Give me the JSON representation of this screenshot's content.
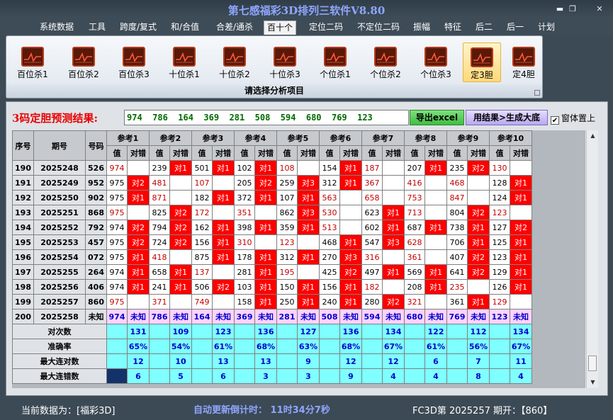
{
  "window": {
    "title": "第七感福彩3D排列三软件V8.80"
  },
  "menu": [
    "系统数据",
    "工具",
    "跨度/复式",
    "和/合值",
    "合差/通杀",
    "百十个",
    "定位二码",
    "不定位二码",
    "振幅",
    "特征",
    "后二",
    "后一",
    "计划"
  ],
  "menu_active": "百十个",
  "ribbon": {
    "buttons": [
      "百位杀1",
      "百位杀2",
      "百位杀3",
      "十位杀1",
      "十位杀2",
      "十位杀3",
      "个位杀1",
      "个位杀2",
      "个位杀3",
      "定3胆",
      "定4胆"
    ],
    "selected": "定3胆",
    "group_caption": "请选择分析项目"
  },
  "prediction": {
    "label": "3码定胆预测结果:",
    "values": "974  786  164  369  281  508  594  680  769  123",
    "export_button": "导出excel",
    "large_button": "用结果>生成大底",
    "checkbox_label": "窗体置上",
    "checkbox_checked": true
  },
  "table": {
    "headers": {
      "seq": "序号",
      "period": "期号",
      "num": "号码",
      "value": "值",
      "result": "对错"
    },
    "refs": [
      "参考1",
      "参考2",
      "参考3",
      "参考4",
      "参考5",
      "参考6",
      "参考7",
      "参考8",
      "参考9",
      "参考10"
    ],
    "rows": [
      {
        "seq": "190",
        "period": "2025248",
        "num": "526",
        "cells": [
          [
            "974",
            "r",
            ""
          ],
          [
            "239",
            "k",
            "对1"
          ],
          [
            "501",
            "k",
            "对1"
          ],
          [
            "102",
            "k",
            "对1"
          ],
          [
            "108",
            "r",
            ""
          ],
          [
            "154",
            "k",
            "对1"
          ],
          [
            "187",
            "r",
            ""
          ],
          [
            "207",
            "k",
            "对1"
          ],
          [
            "235",
            "k",
            "对2"
          ],
          [
            "130",
            "r",
            ""
          ]
        ]
      },
      {
        "seq": "191",
        "period": "2025249",
        "num": "952",
        "cells": [
          [
            "975",
            "k",
            "对2"
          ],
          [
            "481",
            "r",
            ""
          ],
          [
            "107",
            "r",
            ""
          ],
          [
            "205",
            "k",
            "对2"
          ],
          [
            "259",
            "k",
            "对3"
          ],
          [
            "312",
            "k",
            "对1"
          ],
          [
            "367",
            "r",
            ""
          ],
          [
            "416",
            "r",
            ""
          ],
          [
            "468",
            "r",
            ""
          ],
          [
            "128",
            "k",
            "对1"
          ]
        ]
      },
      {
        "seq": "192",
        "period": "2025250",
        "num": "902",
        "cells": [
          [
            "975",
            "k",
            "对1"
          ],
          [
            "871",
            "r",
            ""
          ],
          [
            "182",
            "k",
            "对1"
          ],
          [
            "372",
            "k",
            "对1"
          ],
          [
            "107",
            "k",
            "对1"
          ],
          [
            "563",
            "r",
            ""
          ],
          [
            "658",
            "r",
            ""
          ],
          [
            "753",
            "r",
            ""
          ],
          [
            "847",
            "r",
            ""
          ],
          [
            "124",
            "k",
            "对1"
          ]
        ]
      },
      {
        "seq": "193",
        "period": "2025251",
        "num": "868",
        "cells": [
          [
            "975",
            "r",
            ""
          ],
          [
            "825",
            "k",
            "对2"
          ],
          [
            "172",
            "r",
            ""
          ],
          [
            "351",
            "r",
            ""
          ],
          [
            "862",
            "k",
            "对3"
          ],
          [
            "530",
            "r",
            ""
          ],
          [
            "623",
            "k",
            "对1"
          ],
          [
            "713",
            "r",
            ""
          ],
          [
            "804",
            "k",
            "对2"
          ],
          [
            "123",
            "r",
            ""
          ]
        ]
      },
      {
        "seq": "194",
        "period": "2025252",
        "num": "792",
        "cells": [
          [
            "974",
            "k",
            "对2"
          ],
          [
            "794",
            "k",
            "对2"
          ],
          [
            "162",
            "k",
            "对1"
          ],
          [
            "398",
            "k",
            "对1"
          ],
          [
            "359",
            "k",
            "对1"
          ],
          [
            "513",
            "r",
            ""
          ],
          [
            "602",
            "k",
            "对1"
          ],
          [
            "687",
            "k",
            "对1"
          ],
          [
            "738",
            "k",
            "对1"
          ],
          [
            "127",
            "k",
            "对2"
          ]
        ]
      },
      {
        "seq": "195",
        "period": "2025253",
        "num": "457",
        "cells": [
          [
            "975",
            "k",
            "对2"
          ],
          [
            "724",
            "k",
            "对2"
          ],
          [
            "156",
            "k",
            "对1"
          ],
          [
            "310",
            "r",
            ""
          ],
          [
            "123",
            "r",
            ""
          ],
          [
            "468",
            "k",
            "对1"
          ],
          [
            "547",
            "k",
            "对3"
          ],
          [
            "628",
            "r",
            ""
          ],
          [
            "706",
            "k",
            "对1"
          ],
          [
            "125",
            "k",
            "对1"
          ]
        ]
      },
      {
        "seq": "196",
        "period": "2025254",
        "num": "072",
        "cells": [
          [
            "975",
            "k",
            "对1"
          ],
          [
            "418",
            "r",
            ""
          ],
          [
            "875",
            "k",
            "对1"
          ],
          [
            "178",
            "k",
            "对1"
          ],
          [
            "312",
            "k",
            "对1"
          ],
          [
            "270",
            "k",
            "对3"
          ],
          [
            "316",
            "r",
            ""
          ],
          [
            "361",
            "r",
            ""
          ],
          [
            "407",
            "k",
            "对2"
          ],
          [
            "123",
            "k",
            "对1"
          ]
        ]
      },
      {
        "seq": "197",
        "period": "2025255",
        "num": "264",
        "cells": [
          [
            "974",
            "k",
            "对1"
          ],
          [
            "658",
            "k",
            "对1"
          ],
          [
            "137",
            "r",
            ""
          ],
          [
            "281",
            "k",
            "对1"
          ],
          [
            "195",
            "r",
            ""
          ],
          [
            "425",
            "k",
            "对2"
          ],
          [
            "497",
            "k",
            "对1"
          ],
          [
            "569",
            "k",
            "对1"
          ],
          [
            "641",
            "k",
            "对2"
          ],
          [
            "129",
            "k",
            "对1"
          ]
        ]
      },
      {
        "seq": "198",
        "period": "2025256",
        "num": "406",
        "cells": [
          [
            "974",
            "k",
            "对1"
          ],
          [
            "241",
            "k",
            "对1"
          ],
          [
            "506",
            "k",
            "对2"
          ],
          [
            "103",
            "k",
            "对1"
          ],
          [
            "150",
            "k",
            "对1"
          ],
          [
            "156",
            "k",
            "对1"
          ],
          [
            "182",
            "r",
            ""
          ],
          [
            "208",
            "k",
            "对1"
          ],
          [
            "235",
            "r",
            ""
          ],
          [
            "126",
            "k",
            "对1"
          ]
        ]
      },
      {
        "seq": "199",
        "period": "2025257",
        "num": "860",
        "cells": [
          [
            "975",
            "r",
            ""
          ],
          [
            "371",
            "r",
            ""
          ],
          [
            "749",
            "r",
            ""
          ],
          [
            "158",
            "k",
            "对1"
          ],
          [
            "250",
            "k",
            "对1"
          ],
          [
            "240",
            "k",
            "对1"
          ],
          [
            "280",
            "k",
            "对2"
          ],
          [
            "321",
            "r",
            ""
          ],
          [
            "361",
            "k",
            "对1"
          ],
          [
            "129",
            "r",
            ""
          ]
        ]
      }
    ],
    "pred_row": {
      "seq": "200",
      "period": "2025258",
      "num": "未知",
      "values": [
        "974",
        "786",
        "164",
        "369",
        "281",
        "508",
        "594",
        "680",
        "769",
        "123"
      ],
      "result": "未知"
    },
    "stats": [
      {
        "label": "对次数",
        "values": [
          "131",
          "109",
          "123",
          "136",
          "127",
          "136",
          "134",
          "122",
          "112",
          "134"
        ]
      },
      {
        "label": "准确率",
        "values": [
          "65%",
          "54%",
          "61%",
          "68%",
          "63%",
          "68%",
          "67%",
          "61%",
          "56%",
          "67%"
        ]
      },
      {
        "label": "最大连对数",
        "values": [
          "12",
          "10",
          "13",
          "13",
          "9",
          "12",
          "12",
          "6",
          "7",
          "11"
        ]
      },
      {
        "label": "最大连错数",
        "values": [
          "6",
          "5",
          "6",
          "3",
          "3",
          "9",
          "4",
          "4",
          "8",
          "4"
        ]
      }
    ]
  },
  "status": {
    "current_data": "当前数据为：[福彩3D]",
    "countdown": "自动更新倒计时：  11时34分7秒",
    "period": "FC3D第 2025257 期开：【860】"
  }
}
